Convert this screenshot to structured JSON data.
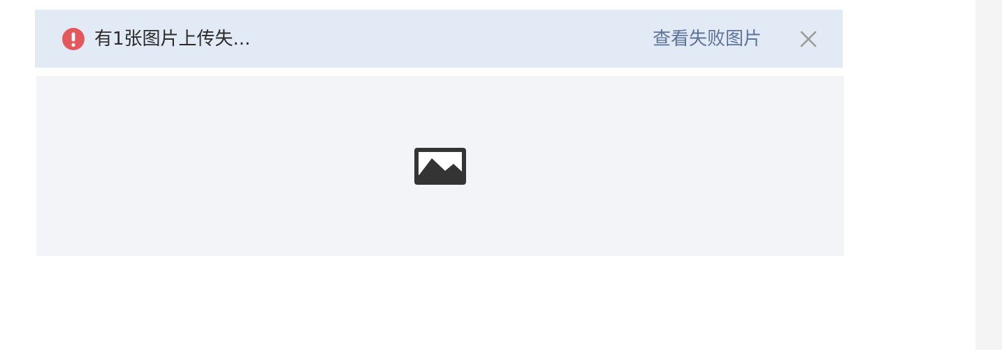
{
  "alert": {
    "icon": "error-exclamation-icon",
    "icon_color": "#e3585c",
    "message": "有1张图片上传失...",
    "link_label": "查看失败图片",
    "link_color": "#5f739a",
    "close_icon": "close-icon",
    "background": "#e2eaf5"
  },
  "image_placeholder": {
    "icon": "image-icon",
    "background": "#f2f4f8"
  }
}
